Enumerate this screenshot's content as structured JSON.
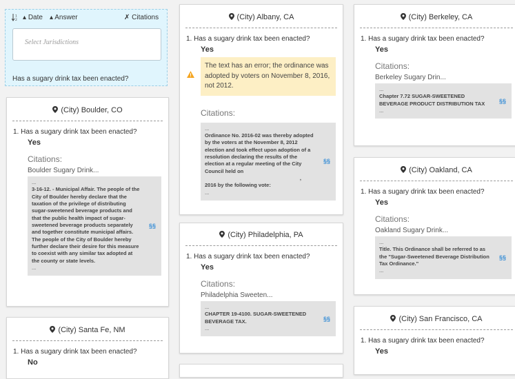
{
  "filter": {
    "sort_icon": "sort-numeric-icon",
    "sort_date": "Date",
    "sort_answer": "Answer",
    "citations": "Citations",
    "jurisdictions_placeholder": "Select Jurisdictions",
    "question": "Has a sugary drink tax been enacted?"
  },
  "colors": {
    "accent": "#3a8fd6",
    "warning_bg": "#fdefc5",
    "warning_icon": "#f5a623",
    "filter_bg": "#e0f5fd"
  },
  "cards": {
    "albany": {
      "title": "(City) Albany, CA",
      "question": "1. Has a sugary drink tax been enacted?",
      "answer": "Yes",
      "warning": "The text has an error; the ordinance was adopted by voters on November 8, 2016, not 2012.",
      "citations_label": "Citations:",
      "excerpt_top": "...",
      "excerpt": "Ordinance No. 2016-02 was thereby adopted by the voters at the November 8, 2012 election and took effect upon adoption of a resolution declaring the results of the election at a regular meeting of the City Council held on",
      "excerpt_comma": ",",
      "excerpt_tail": "2016 by the following vote:",
      "excerpt_end": "...",
      "section": "§§"
    },
    "berkeley": {
      "title": "(City) Berkeley, CA",
      "question": "1. Has a sugary drink tax been enacted?",
      "answer": "Yes",
      "citations_label": "Citations:",
      "link": "Berkeley Sugary Drin...",
      "excerpt_top": "...",
      "excerpt": "Chapter 7.72 SUGAR-SWEETENED BEVERAGE PRODUCT DISTRIBUTION TAX",
      "excerpt_end": "...",
      "section": "§§"
    },
    "boulder": {
      "title": "(City) Boulder, CO",
      "question": "1. Has a sugary drink tax been enacted?",
      "answer": "Yes",
      "citations_label": "Citations:",
      "link": "Boulder Sugary Drink...",
      "excerpt_top": "...",
      "excerpt": "3-16-12. - Municipal Affair. The people of the City of Boulder hereby declare that the taxation of the privilege of distributing sugar-sweetened beverage products and that the public health impact of sugar- sweetened beverage products separately and together constitute municipal affairs. The people of the City of Boulder hereby further declare their desire for this measure to coexist with any similar tax adopted at the county or state levels.",
      "excerpt_end": "...",
      "section": "§§"
    },
    "oakland": {
      "title": "(City) Oakland, CA",
      "question": "1. Has a sugary drink tax been enacted?",
      "answer": "Yes",
      "citations_label": "Citations:",
      "link": "Oakland Sugary Drink...",
      "excerpt_top": "...",
      "excerpt": "Title. This Ordinance shall be referred to as the \"Sugar-Sweetened Beverage Distribution Tax Ordinance.\"",
      "excerpt_end": "...",
      "section": "§§"
    },
    "philadelphia": {
      "title": "(City) Philadelphia, PA",
      "question": "1. Has a sugary drink tax been enacted?",
      "answer": "Yes",
      "citations_label": "Citations:",
      "link": "Philadelphia Sweeten...",
      "excerpt_top": "...",
      "excerpt": "CHAPTER 19-4100. SUGAR-SWEETENED BEVERAGE TAX.",
      "excerpt_end": "...",
      "section": "§§"
    },
    "santafe": {
      "title": "(City) Santa Fe, NM",
      "question": "1. Has a sugary drink tax been enacted?",
      "answer": "No"
    },
    "sanfrancisco": {
      "title": "(City) San Francisco, CA",
      "question": "1. Has a sugary drink tax been enacted?",
      "answer": "Yes"
    }
  }
}
